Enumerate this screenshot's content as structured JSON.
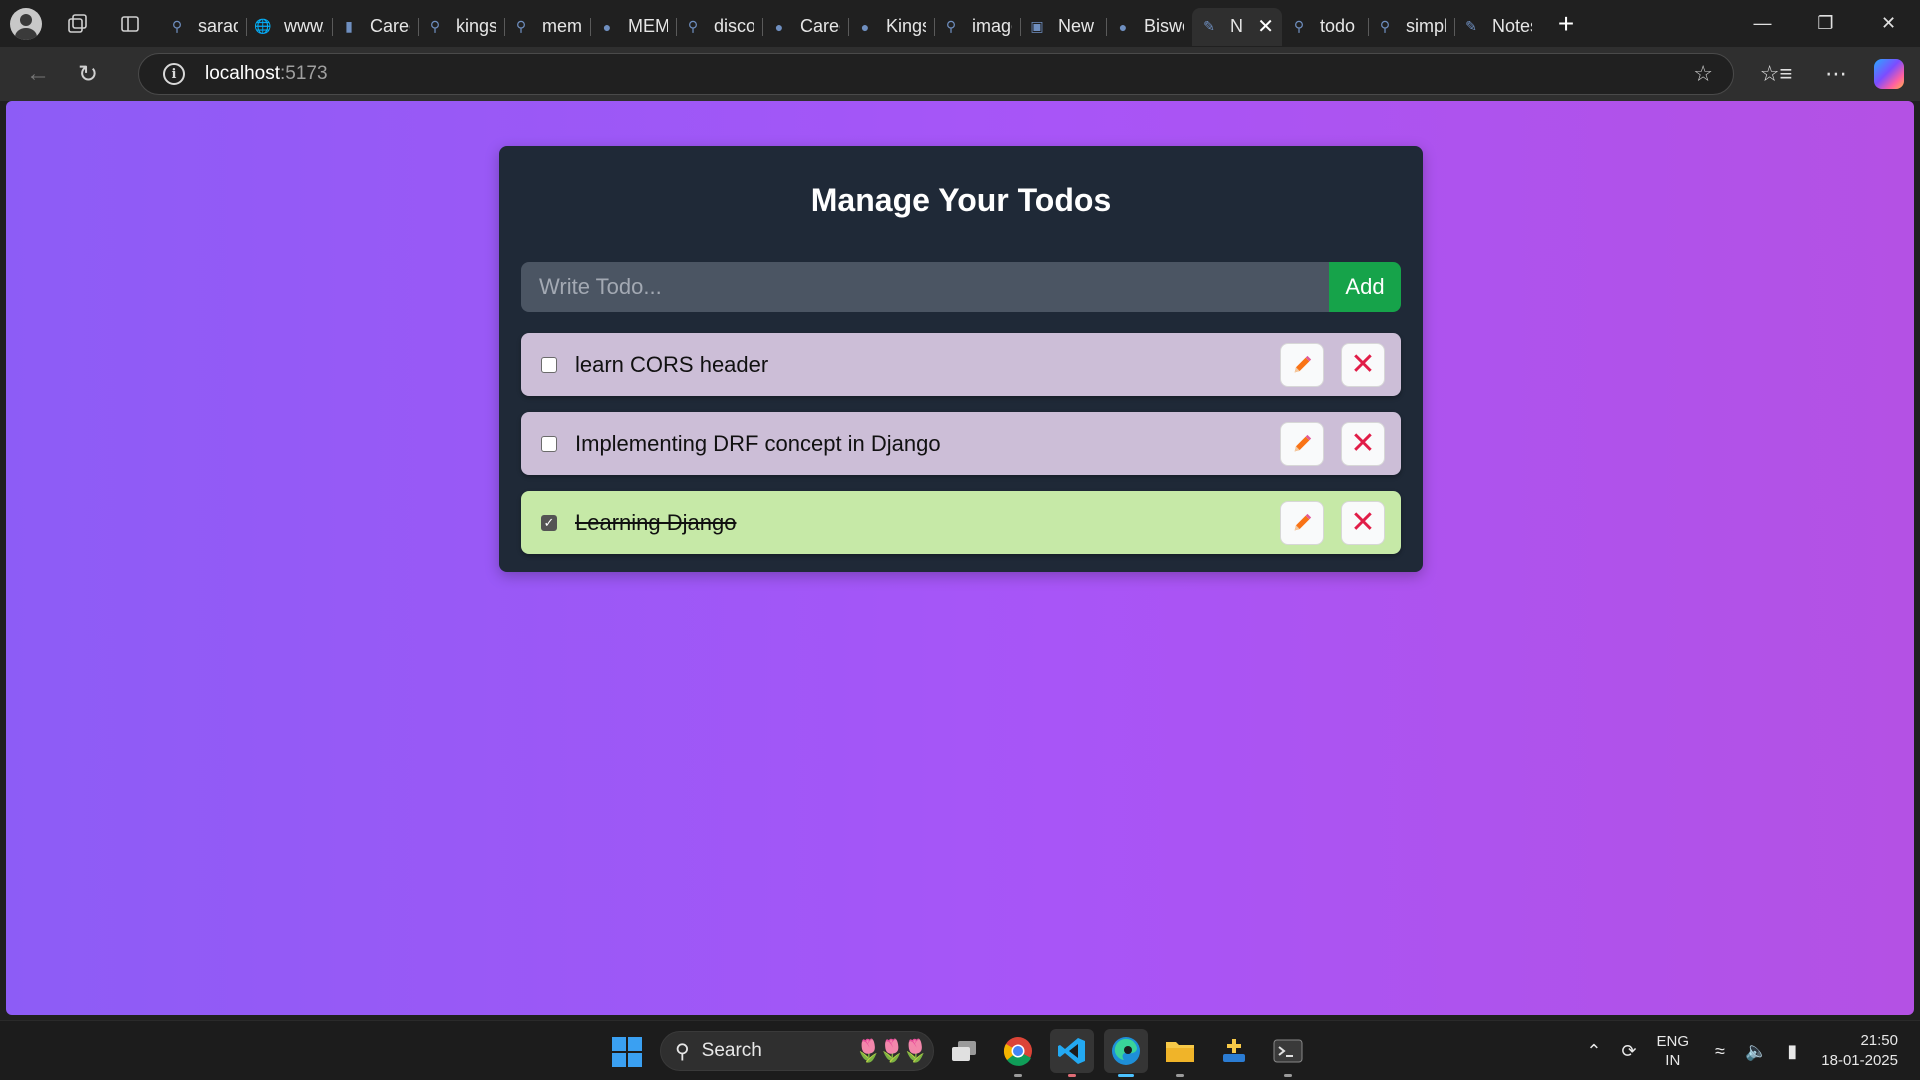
{
  "browser": {
    "tabs": [
      {
        "label": "sarada",
        "icon": "search-icon"
      },
      {
        "label": "www.s",
        "icon": "globe-icon"
      },
      {
        "label": "Career",
        "icon": "bookmark-icon"
      },
      {
        "label": "kingsr",
        "icon": "search-icon"
      },
      {
        "label": "memp",
        "icon": "search-icon"
      },
      {
        "label": "MEMK",
        "icon": "site-icon"
      },
      {
        "label": "discov",
        "icon": "search-icon"
      },
      {
        "label": "Career",
        "icon": "site-icon"
      },
      {
        "label": "Kingsr",
        "icon": "site-icon"
      },
      {
        "label": "image",
        "icon": "search-icon"
      },
      {
        "label": "New t",
        "icon": "newtab-icon"
      },
      {
        "label": "Biswo",
        "icon": "site-icon"
      },
      {
        "label": "N",
        "icon": "notes-icon",
        "active": true
      },
      {
        "label": "todo a",
        "icon": "search-icon"
      },
      {
        "label": "simple",
        "icon": "search-icon"
      },
      {
        "label": "Notes",
        "icon": "notes-icon"
      }
    ],
    "address": {
      "host": "localhost",
      "port": ":5173"
    }
  },
  "app": {
    "title": "Manage Your Todos",
    "input_placeholder": "Write Todo...",
    "add_label": "Add",
    "todos": [
      {
        "text": "learn CORS header",
        "completed": false
      },
      {
        "text": "Implementing DRF concept in Django",
        "completed": false
      },
      {
        "text": "Learning Django",
        "completed": true
      }
    ],
    "colors": {
      "background_start": "#8d5cf6",
      "background_end": "#b451e4",
      "card": "#1f2937",
      "input": "#4b5563",
      "add_button": "#16a34a",
      "todo_pending": "#ccbed7",
      "todo_done": "#c6e9a7",
      "edit_icon": "#f97316",
      "delete_icon": "#e11d48"
    }
  },
  "taskbar": {
    "search_label": "Search",
    "language": {
      "line1": "ENG",
      "line2": "IN"
    },
    "time": "21:50",
    "date": "18-01-2025"
  }
}
